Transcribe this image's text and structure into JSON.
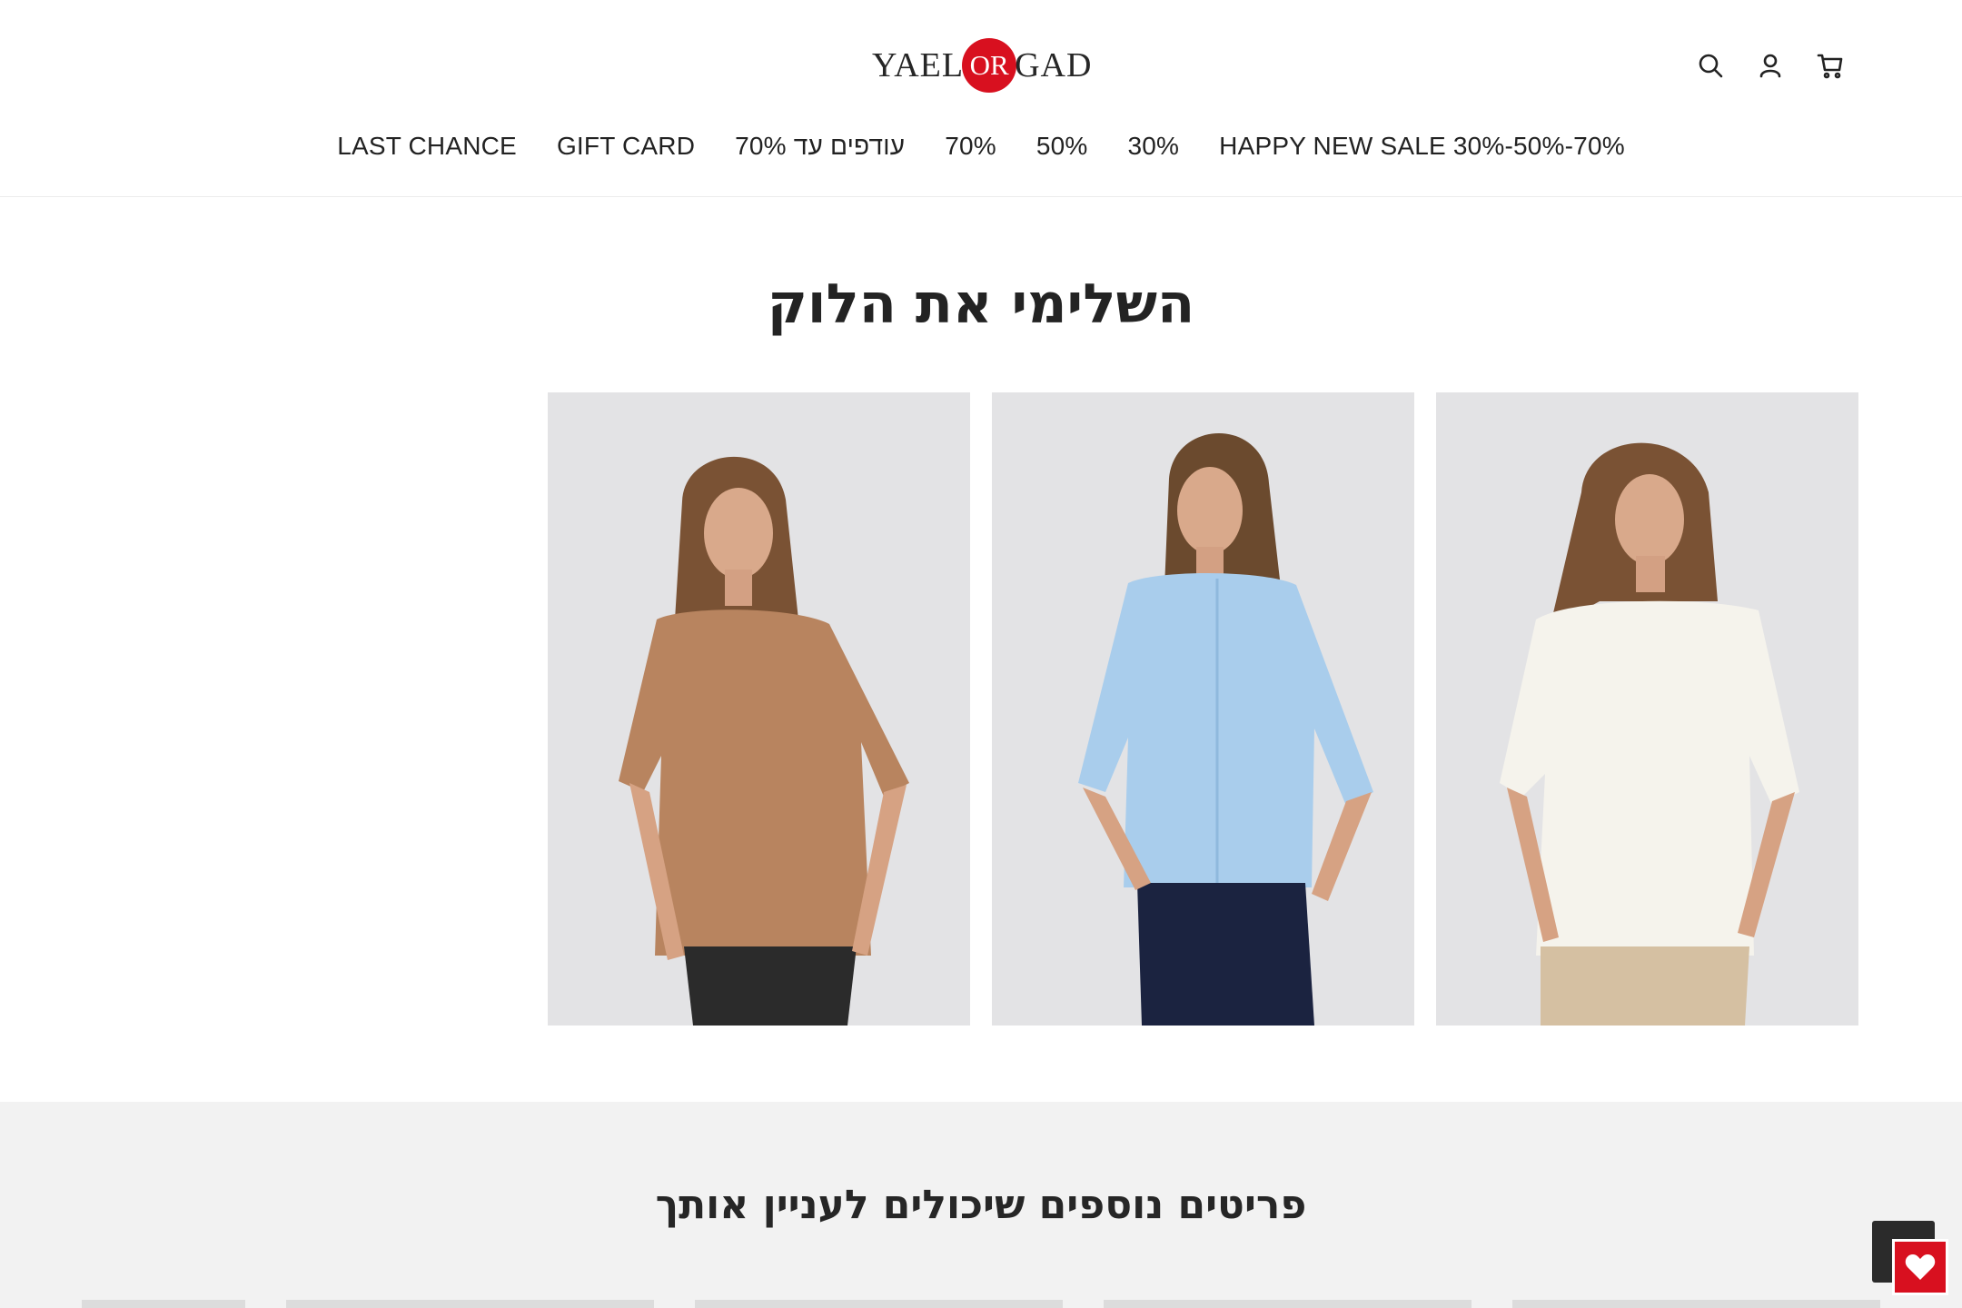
{
  "header": {
    "logo_left": "YAEL",
    "logo_mid": "OR",
    "logo_right": "GAD",
    "icons": [
      "search-icon",
      "account-icon",
      "cart-icon"
    ],
    "brand_color": "#d8101f"
  },
  "nav": {
    "items": [
      "LAST CHANCE",
      "GIFT CARD",
      "עודפים עד 70%",
      "70%",
      "50%",
      "30%",
      "HAPPY NEW SALE 30%-50%-70%"
    ]
  },
  "complete_look": {
    "title": "השלימי את הלוק",
    "products": [
      {
        "image": "model in brown oversized t-shirt"
      },
      {
        "image": "model in light blue button blouse"
      },
      {
        "image": "model in off-white oversized top"
      }
    ]
  },
  "recommendations": {
    "title": "פריטים נוספים שיכולים לעניין אותך"
  },
  "widgets": {
    "wishlist_icon": "heart-icon",
    "scroll_icon": "scroll-to-top"
  }
}
